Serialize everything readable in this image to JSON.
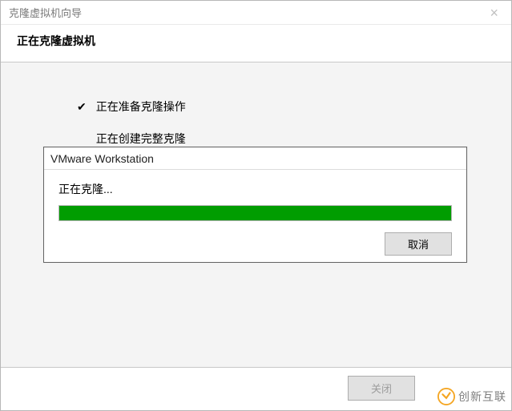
{
  "window": {
    "title": "克隆虚拟机向导",
    "close_label": "×"
  },
  "header": {
    "title": "正在克隆虚拟机"
  },
  "steps": [
    {
      "done": true,
      "label": "正在准备克隆操作"
    },
    {
      "done": false,
      "label": "正在创建完整克隆"
    }
  ],
  "dialog": {
    "title": "VMware Workstation",
    "status": "正在克隆...",
    "progress_percent": 100,
    "progress_color": "#019d01",
    "cancel": "取消"
  },
  "footer": {
    "close": "关闭"
  },
  "watermark": {
    "text": "创新互联"
  }
}
